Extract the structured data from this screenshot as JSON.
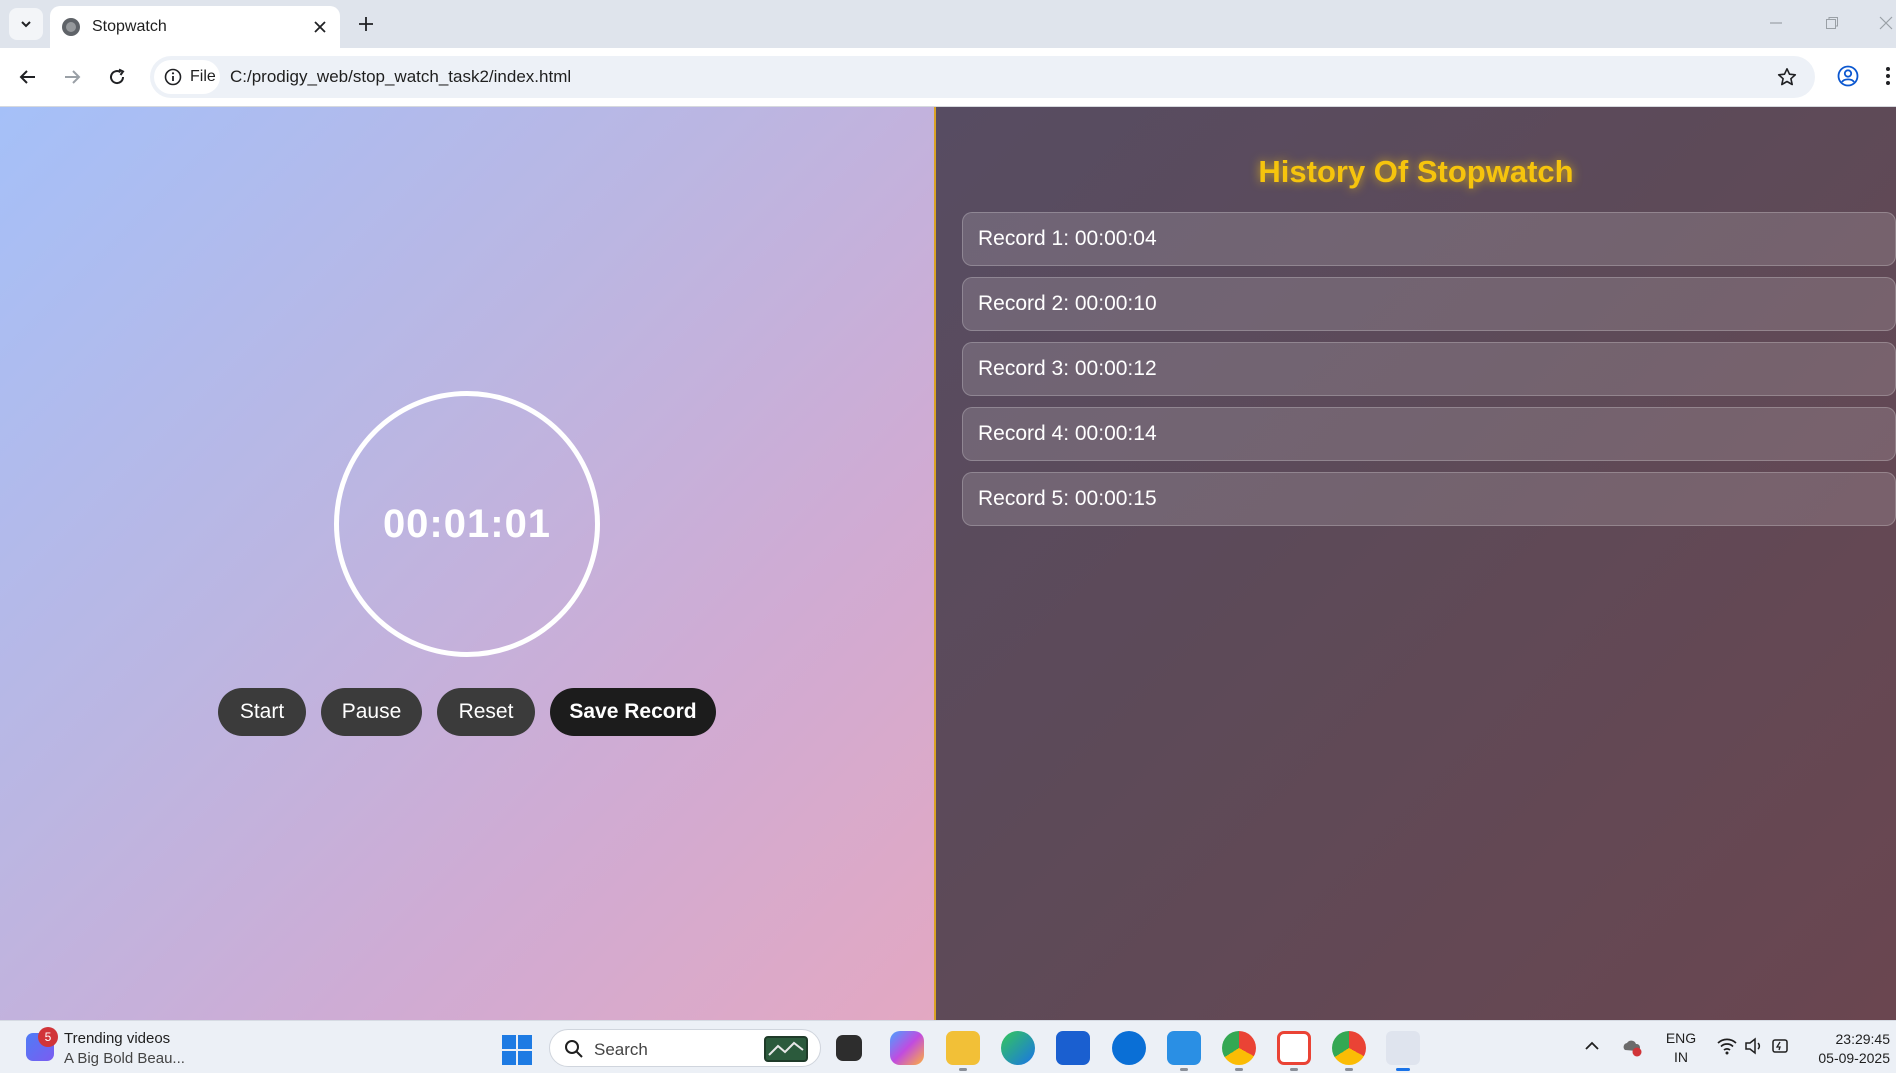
{
  "browser": {
    "tab_title": "Stopwatch",
    "site_chip_label": "File",
    "url": "C:/prodigy_web/stop_watch_task2/index.html"
  },
  "page": {
    "time_display": "00:01:01",
    "buttons": {
      "start": "Start",
      "pause": "Pause",
      "reset": "Reset",
      "save": "Save Record"
    },
    "history_title": "History Of Stopwatch",
    "records": [
      "Record 1: 00:00:04",
      "Record 2: 00:00:10",
      "Record 3: 00:00:12",
      "Record 4: 00:00:14",
      "Record 5: 00:00:15"
    ],
    "colors": {
      "title_accent": "#f6c40d",
      "divider": "#d9a324"
    }
  },
  "taskbar": {
    "widget_badge": "5",
    "widget_title": "Trending videos",
    "widget_subtitle": "A Big Bold Beau...",
    "search_label": "Search",
    "lang_line1": "ENG",
    "lang_line2": "IN",
    "time": "23:29:45",
    "date": "05-09-2025"
  }
}
